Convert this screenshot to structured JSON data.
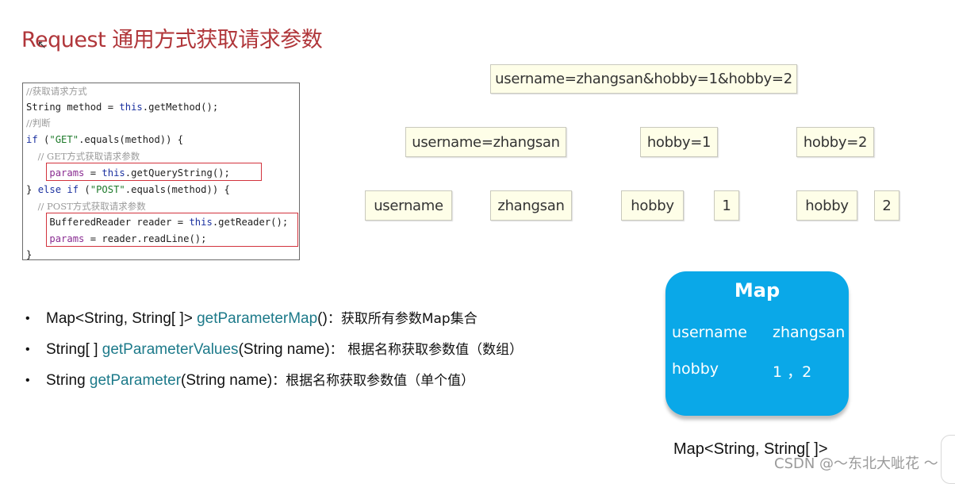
{
  "slide": {
    "title": "Request 通用方式获取请求参数"
  },
  "code": {
    "lines": [
      {
        "parts": [
          {
            "t": "//获取请求方式",
            "c": "cm"
          }
        ]
      },
      {
        "parts": [
          {
            "t": "String method = ",
            "c": ""
          },
          {
            "t": "this",
            "c": "kw"
          },
          {
            "t": ".getMethod();",
            "c": ""
          }
        ]
      },
      {
        "parts": [
          {
            "t": "//判断",
            "c": "cm"
          }
        ]
      },
      {
        "parts": [
          {
            "t": "if",
            "c": "kw"
          },
          {
            "t": " (",
            "c": ""
          },
          {
            "t": "\"GET\"",
            "c": "str"
          },
          {
            "t": ".equals(method)) {",
            "c": ""
          }
        ]
      },
      {
        "parts": [
          {
            "t": "    // GET方式获取请求参数",
            "c": "cm"
          }
        ]
      },
      {
        "parts": [
          {
            "t": "    ",
            "c": ""
          },
          {
            "t": "params",
            "c": "fld"
          },
          {
            "t": " = ",
            "c": ""
          },
          {
            "t": "this",
            "c": "kw"
          },
          {
            "t": ".getQueryString();",
            "c": ""
          }
        ]
      },
      {
        "parts": [
          {
            "t": "} ",
            "c": ""
          },
          {
            "t": "else if",
            "c": "kw"
          },
          {
            "t": " (",
            "c": ""
          },
          {
            "t": "\"POST\"",
            "c": "str"
          },
          {
            "t": ".equals(method)) {",
            "c": ""
          }
        ]
      },
      {
        "parts": [
          {
            "t": "    // POST方式获取请求参数",
            "c": "cm"
          }
        ]
      },
      {
        "parts": [
          {
            "t": "    BufferedReader reader = ",
            "c": ""
          },
          {
            "t": "this",
            "c": "kw"
          },
          {
            "t": ".getReader();",
            "c": ""
          }
        ]
      },
      {
        "parts": [
          {
            "t": "    ",
            "c": ""
          },
          {
            "t": "params",
            "c": "fld"
          },
          {
            "t": " = reader.readLine();",
            "c": ""
          }
        ]
      },
      {
        "parts": [
          {
            "t": "}",
            "c": ""
          }
        ]
      }
    ]
  },
  "diagram": {
    "query_string": "username=zhangsan&hobby=1&hobby=2",
    "pairs": [
      "username=zhangsan",
      "hobby=1",
      "hobby=2"
    ],
    "parts": [
      "username",
      "zhangsan",
      "hobby",
      "1",
      "hobby",
      "2"
    ]
  },
  "methods": [
    {
      "pre": "Map<String, String[ ]> ",
      "name": "getParameterMap",
      "post": "()",
      "desc": "：获取所有参数Map集合"
    },
    {
      "pre": "String[ ] ",
      "name": "getParameterValues",
      "post": "(String name)",
      "desc": "： 根据名称获取参数值（数组）"
    },
    {
      "pre": "String ",
      "name": "getParameter",
      "post": "(String name)",
      "desc": "：根据名称获取参数值（单个值）"
    }
  ],
  "map_card": {
    "title": "Map",
    "rows": [
      {
        "key": "username",
        "value": "zhangsan"
      },
      {
        "key": "hobby",
        "value": "1 ，2"
      }
    ],
    "caption": "Map<String, String[ ]>"
  },
  "watermark": "CSDN @～东北大呲花 ～",
  "colors": {
    "title": "#b0363a",
    "method_name": "#1d7a8a",
    "map_bg": "#0aa8e8",
    "box_bg": "#fefee8",
    "highlight_border": "#d2333d"
  }
}
